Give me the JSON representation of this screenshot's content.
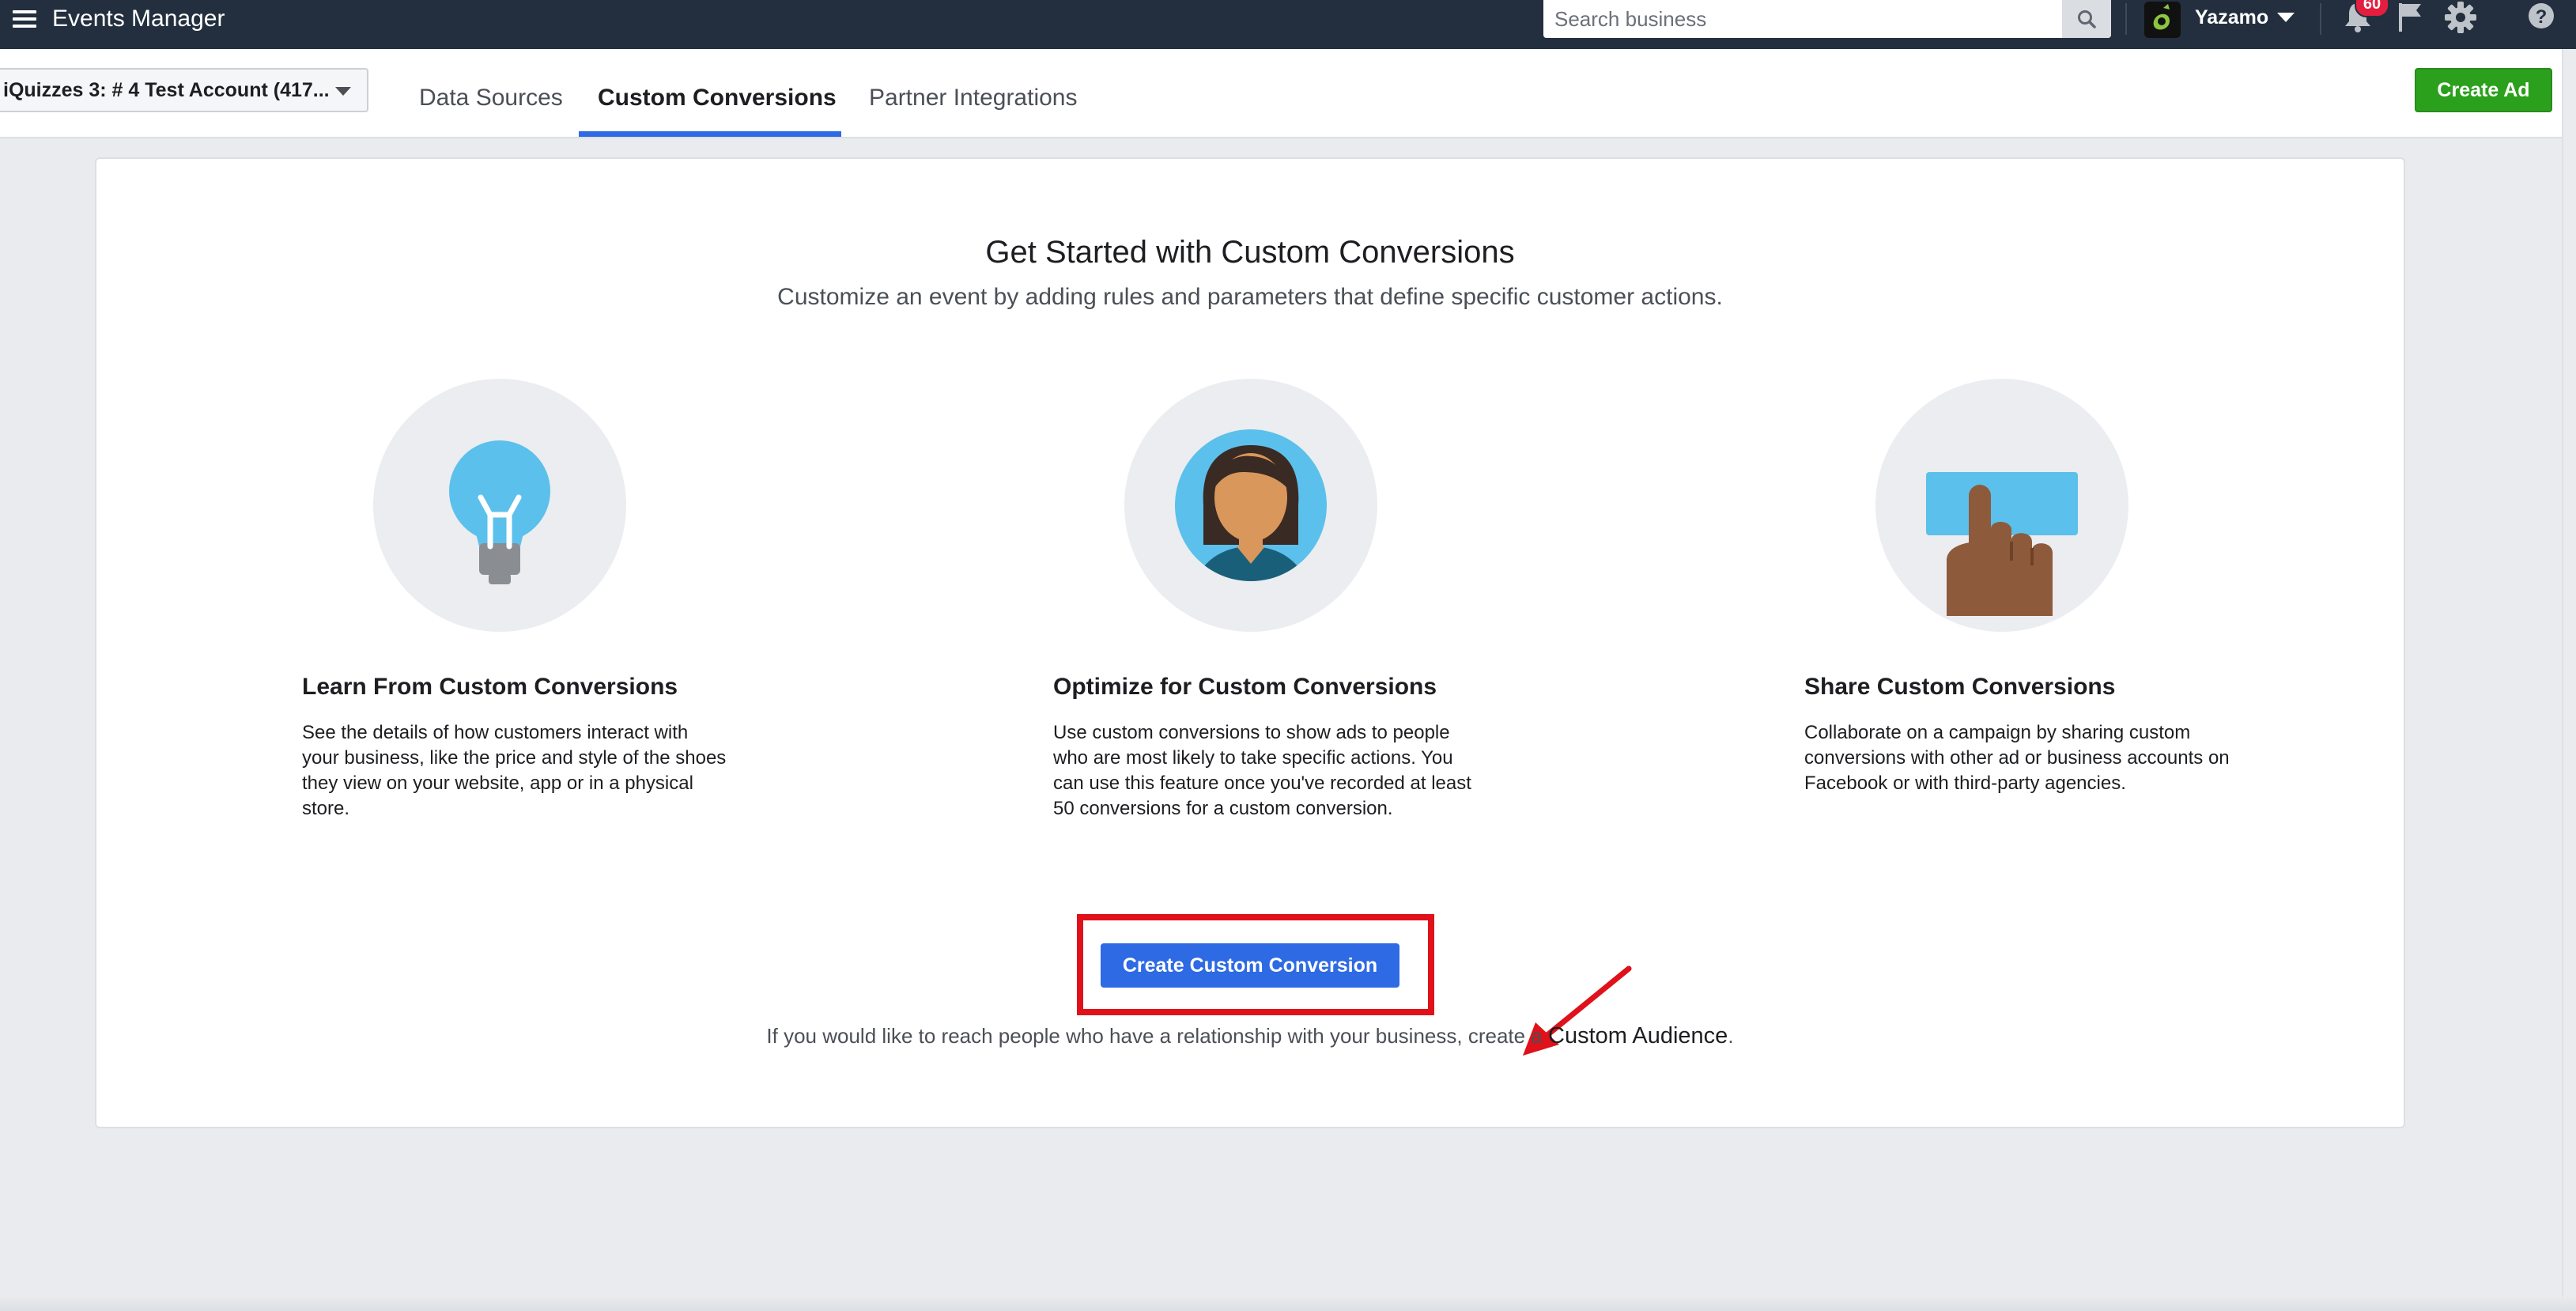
{
  "topbar": {
    "title": "Events Manager",
    "search_placeholder": "Search business",
    "username": "Yazamo",
    "notification_count": "60",
    "icons": [
      "menu-icon",
      "search-icon",
      "caret-down-icon",
      "bell-icon",
      "flag-icon",
      "gear-icon",
      "help-icon"
    ]
  },
  "subnav": {
    "account": "iQuizzes 3: # 4 Test Account (417...",
    "tabs": [
      {
        "label": "Data Sources",
        "active": false
      },
      {
        "label": "Custom Conversions",
        "active": true
      },
      {
        "label": "Partner Integrations",
        "active": false
      }
    ],
    "create_ad": "Create Ad"
  },
  "main": {
    "headline": "Get Started with Custom Conversions",
    "subhead": "Customize an event by adding rules and parameters that define specific customer actions.",
    "features": [
      {
        "icon": "lightbulb-icon",
        "title": "Learn From Custom Conversions",
        "text": "See the details of how customers interact with your business, like the price and style of the shoes they view on your website, app or in a physical store."
      },
      {
        "icon": "person-icon",
        "title": "Optimize for Custom Conversions",
        "text": "Use custom conversions to show ads to people who are most likely to take specific actions. You can use this feature once you've recorded at least 50 conversions for a custom conversion."
      },
      {
        "icon": "hand-pointing-icon",
        "title": "Share Custom Conversions",
        "text": "Collaborate on a campaign by sharing custom conversions with other ad or business accounts on Facebook or with third-party agencies."
      }
    ],
    "cta": "Create Custom Conversion",
    "footer_prefix": "If you would like to reach people who have a relationship with your business, create a",
    "footer_link": "Custom Audience",
    "footer_suffix": "."
  },
  "colors": {
    "topbar": "#232f3e",
    "primary": "#2d6ae4",
    "create_ad": "#2ba01c",
    "highlight": "#e0111a"
  }
}
